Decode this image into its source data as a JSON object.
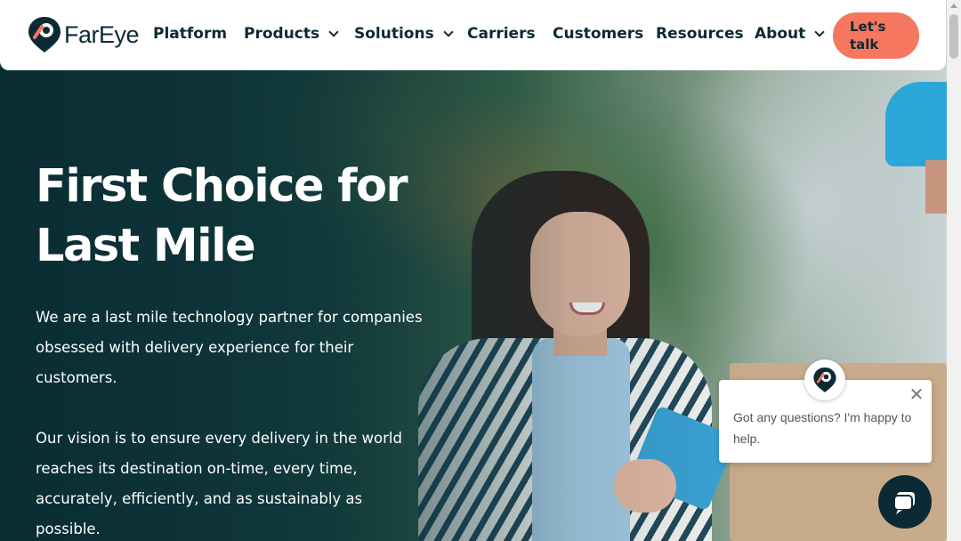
{
  "header": {
    "logo_text": "FarEye",
    "nav": [
      {
        "label": "Platform",
        "dropdown": false
      },
      {
        "label": "Products",
        "dropdown": true
      },
      {
        "label": "Solutions",
        "dropdown": true
      },
      {
        "label": "Carriers",
        "dropdown": false
      },
      {
        "label": "Customers",
        "dropdown": false
      },
      {
        "label": "Resources",
        "dropdown": false
      },
      {
        "label": "About",
        "dropdown": true
      }
    ],
    "cta_label": "Let's talk"
  },
  "hero": {
    "headline": "First Choice for Last Mile",
    "paragraph_1": "We are a last mile technology partner for companies obsessed with delivery experience for their customers.",
    "paragraph_2": "Our vision is to ensure every delivery in the world reaches its destination on-time, every time, accurately, efficiently, and as sustainably as possible."
  },
  "chat": {
    "message": "Got any questions? I'm happy to help.",
    "close_icon": "close-icon",
    "launcher_icon": "chat-bubble-icon"
  },
  "colors": {
    "brand_dark": "#0b2a35",
    "cta": "#f6775f",
    "hero_overlay": "#0d3940"
  }
}
